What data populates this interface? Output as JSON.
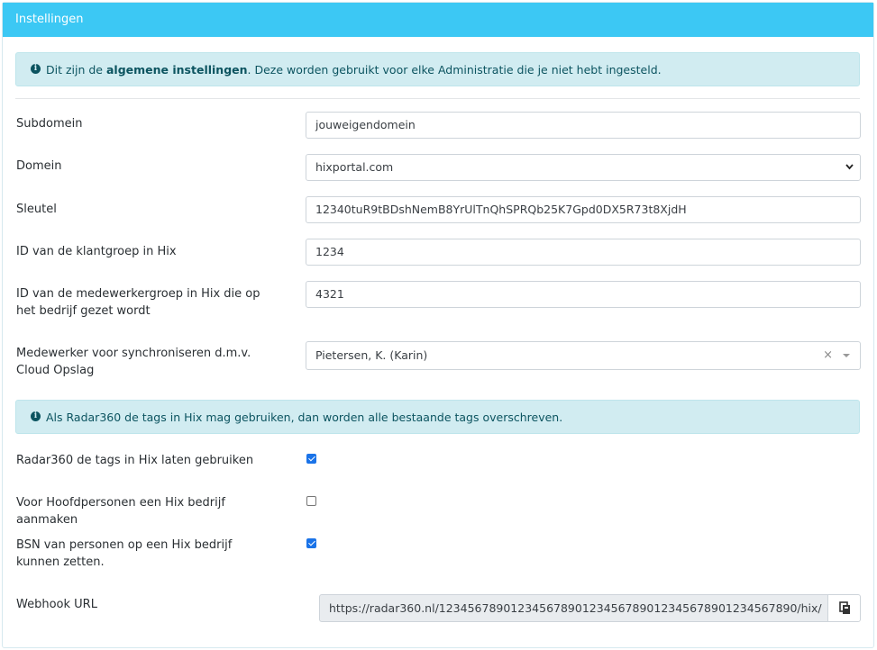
{
  "header": {
    "title": "Instellingen"
  },
  "alert_general": {
    "text_before": "Dit zijn de ",
    "text_bold": "algemene instellingen",
    "text_after": ". Deze worden gebruikt voor elke Administratie die je niet hebt ingesteld."
  },
  "fields": {
    "subdomain": {
      "label": "Subdomein",
      "value": "jouweigendomein"
    },
    "domain": {
      "label": "Domein",
      "value": "hixportal.com"
    },
    "key": {
      "label": "Sleutel",
      "value": "12340tuR9tBDshNemB8YrUlTnQhSPRQb25K7Gpd0DX5R73t8XjdH"
    },
    "client_group": {
      "label": "ID van de klantgroep in Hix",
      "value": "1234"
    },
    "employee_group": {
      "label": "ID van de medewerkergroep in Hix die op het bedrijf gezet wordt",
      "value": "4321"
    },
    "sync_employee": {
      "label": "Medewerker voor synchroniseren d.m.v. Cloud Opslag",
      "value": "Pietersen, K. (Karin)",
      "clear": "×"
    }
  },
  "alert_tags": {
    "text": "Als Radar360 de tags in Hix mag gebruiken, dan worden alle bestaande tags overschreven."
  },
  "checkboxes": {
    "use_tags": {
      "label": "Radar360 de tags in Hix laten gebruiken",
      "checked": true
    },
    "main_persons": {
      "label": "Voor Hoofdpersonen een Hix bedrijf aanmaken",
      "checked": false
    },
    "bsn": {
      "label": "BSN van personen op een Hix bedrijf kunnen zetten.",
      "checked": true
    }
  },
  "webhook": {
    "label": "Webhook URL",
    "value": "https://radar360.nl/12345678901234567890123456789012345678901234567890/hix/"
  },
  "icons": {
    "info": "info-circle-icon",
    "chevron": "chevron-down-icon",
    "copy": "copy-icon"
  },
  "colors": {
    "header": "#3cc8f4",
    "alert_bg": "#d1ecf1",
    "alert_text": "#0c5460",
    "checkbox": "#1a73e8"
  }
}
